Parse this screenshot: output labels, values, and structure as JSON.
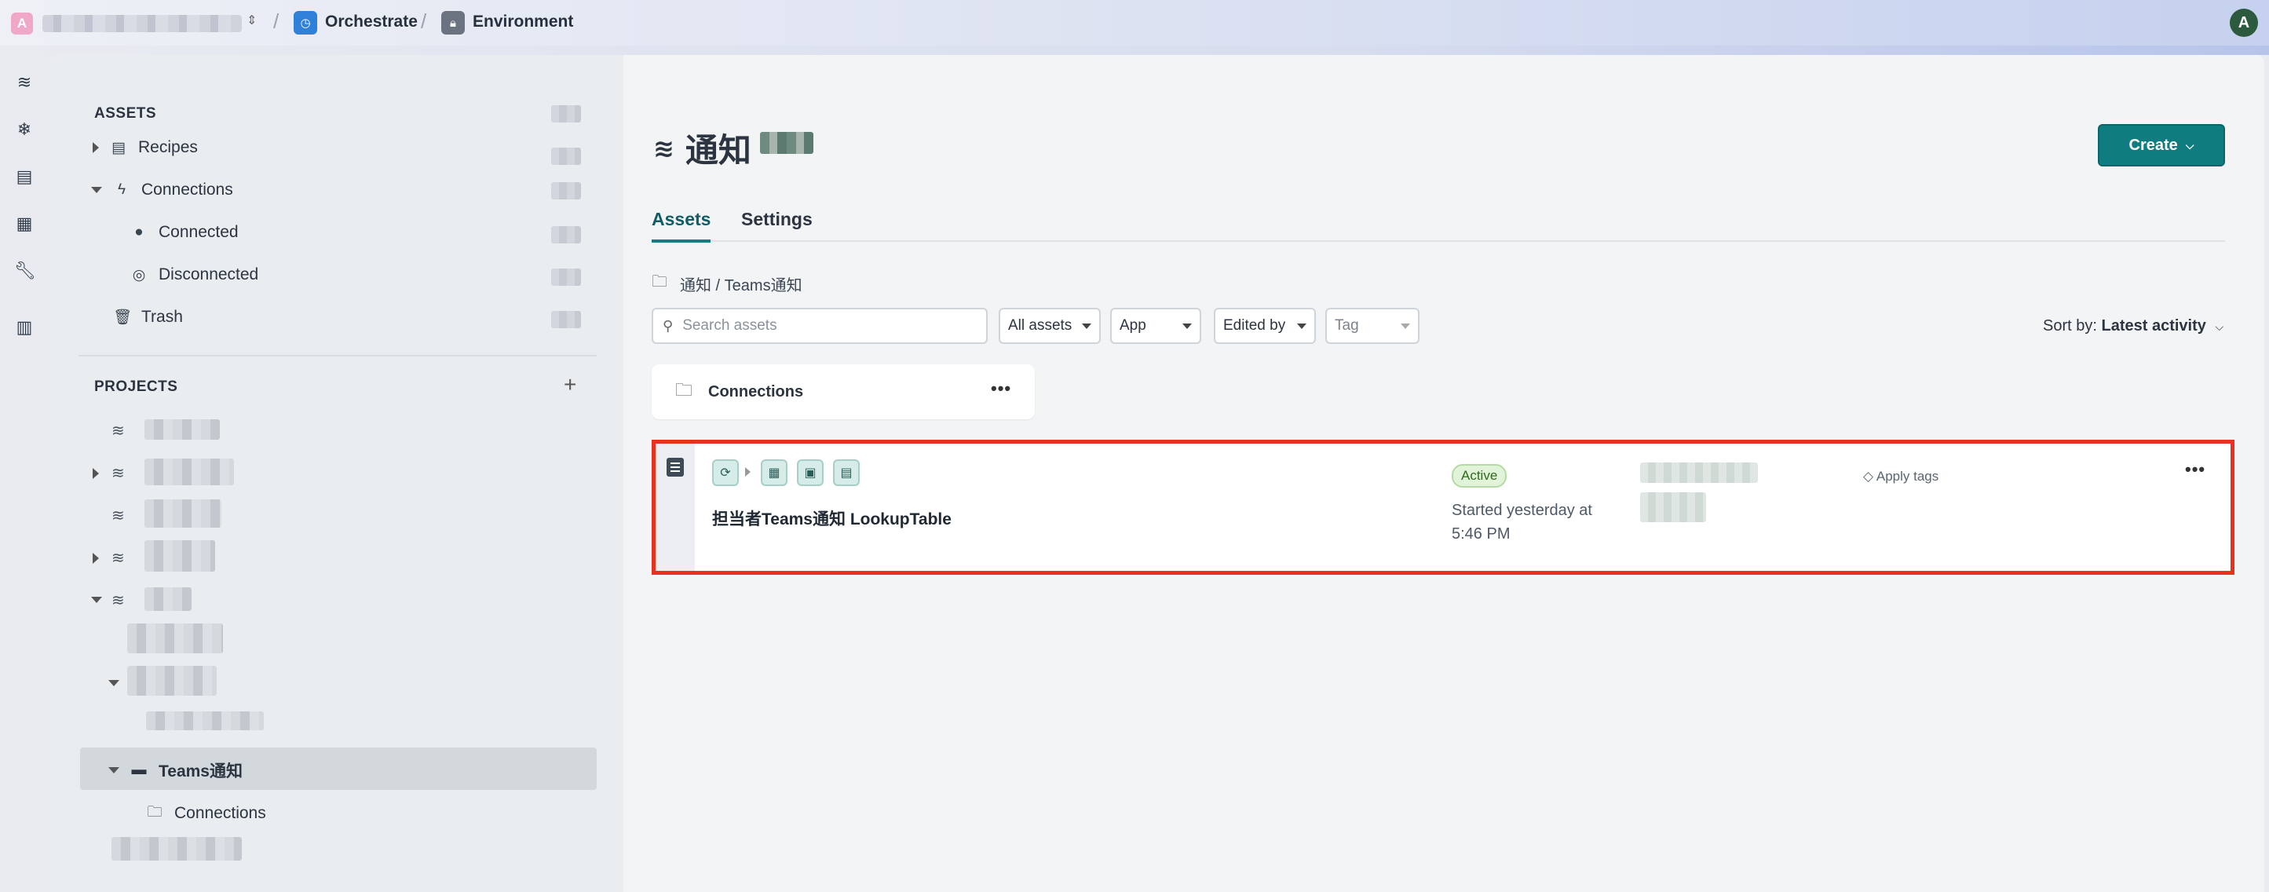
{
  "topbar": {
    "workspace_initial": "A",
    "breadcrumb": [
      {
        "label": "Orchestrate"
      },
      {
        "label": "Environment"
      }
    ],
    "user_initial": "A"
  },
  "sidebar": {
    "assets_title": "ASSETS",
    "assets": [
      {
        "label": "Recipes"
      },
      {
        "label": "Connections"
      },
      {
        "label": "Connected"
      },
      {
        "label": "Disconnected"
      },
      {
        "label": "Trash"
      }
    ],
    "projects_title": "PROJECTS",
    "selected_folder": "Teams通知",
    "selected_child": "Connections"
  },
  "main": {
    "project_title": "通知",
    "create_label": "Create",
    "tabs": [
      {
        "label": "Assets"
      },
      {
        "label": "Settings"
      }
    ],
    "path": "通知 / Teams通知",
    "search_placeholder": "Search assets",
    "filters": [
      {
        "label": "All assets"
      },
      {
        "label": "App"
      },
      {
        "label": "Edited by"
      },
      {
        "label": "Tag"
      }
    ],
    "sort_prefix": "Sort by:",
    "sort_value": "Latest activity",
    "folder_card_label": "Connections",
    "recipe": {
      "title": "担当者Teams通知 LookupTable",
      "status": "Active",
      "started": "Started yesterday at 5:46 PM",
      "apply_tags": "Apply tags"
    }
  },
  "colors": {
    "accent": "#0f7d7f",
    "highlight_border": "#e8321f",
    "active_badge_bg": "#e1f3d8"
  }
}
